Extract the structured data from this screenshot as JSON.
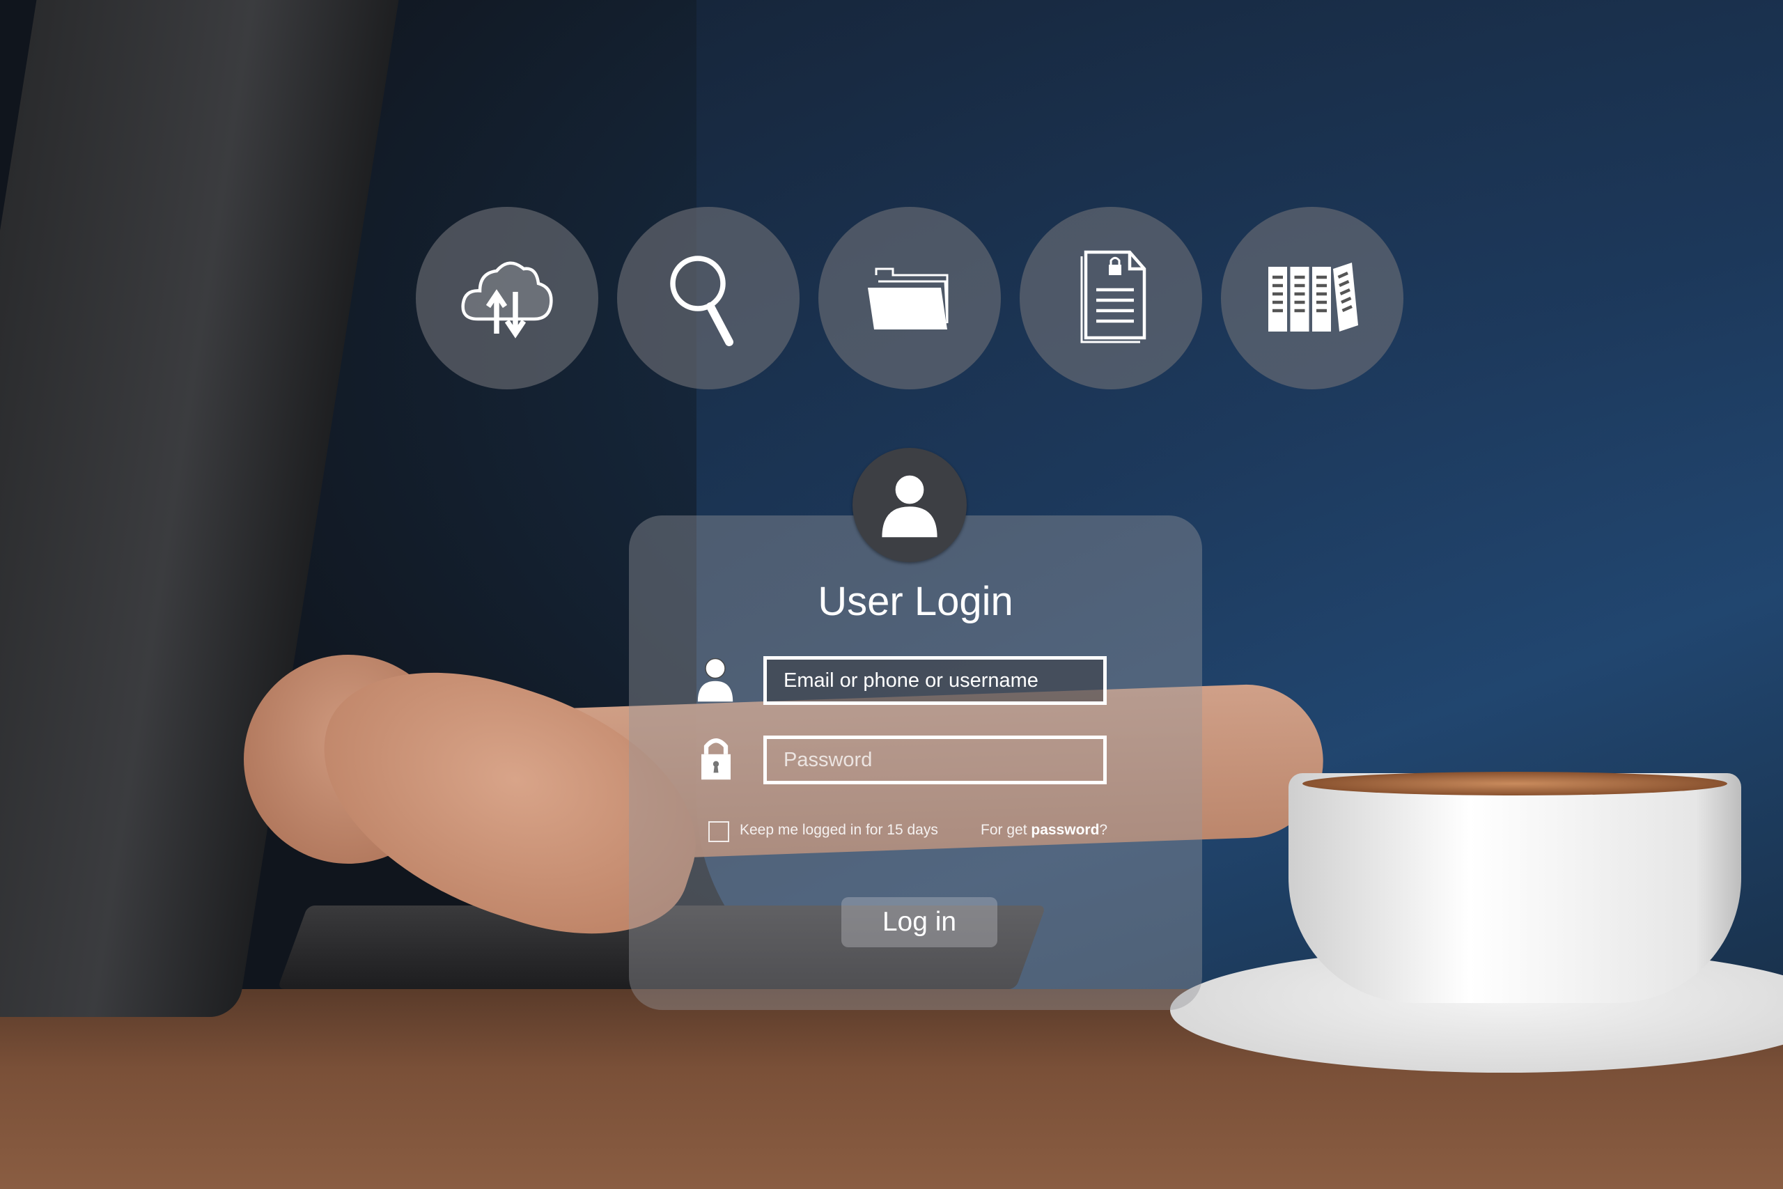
{
  "feature_icons": [
    {
      "name": "cloud-sync-icon",
      "label": "cloud upload download"
    },
    {
      "name": "search-icon",
      "label": "search"
    },
    {
      "name": "folder-icon",
      "label": "folder"
    },
    {
      "name": "locked-document-icon",
      "label": "secure document"
    },
    {
      "name": "binders-icon",
      "label": "file archive"
    }
  ],
  "login": {
    "title": "User Login",
    "username_placeholder": "Email or phone or username",
    "username_value": "",
    "password_placeholder": "Password",
    "password_value": "",
    "remember_label": "Keep me logged in for 15 days",
    "remember_checked": false,
    "forgot_prefix": "For get ",
    "forgot_bold": "password",
    "forgot_suffix": "?",
    "submit_label": "Log in"
  },
  "colors": {
    "card_bg": "#96969b",
    "icon_circle": "#6e7076",
    "text": "#ffffff"
  }
}
